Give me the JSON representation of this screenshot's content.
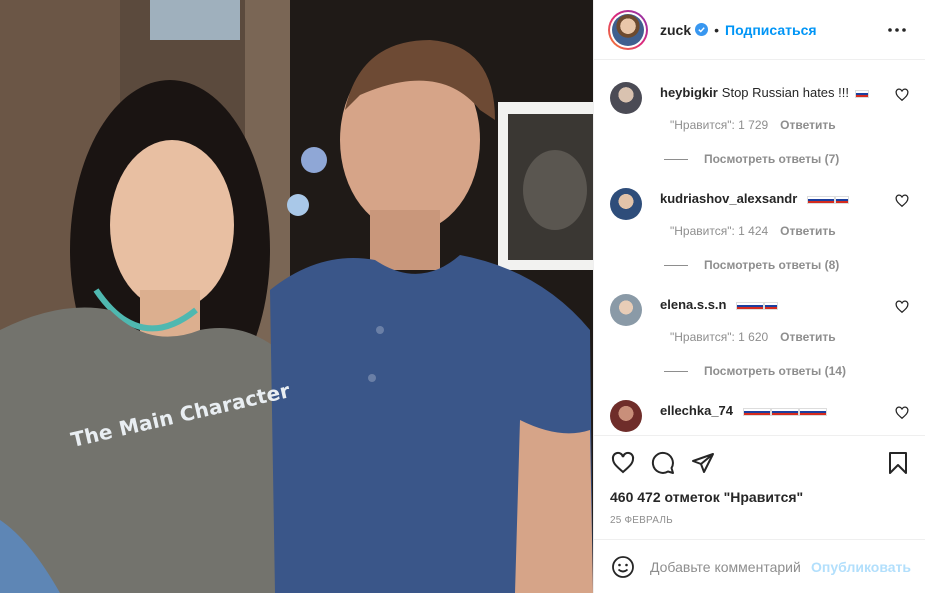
{
  "post": {
    "shirt_text": "The Main Character"
  },
  "header": {
    "username": "zuck",
    "separator": "•",
    "follow_label": "Подписаться",
    "more_icon": "more-horizontal-icon"
  },
  "comments": [
    {
      "username": "heybigkir",
      "text": "Stop Russian hates !!!",
      "flag": "ru",
      "likes": "\"Нравится\": 1 729",
      "reply": "Ответить",
      "view_replies": "Посмотреть ответы (7)"
    },
    {
      "username": "kudriashov_alexsandr",
      "text": "",
      "flag": "ru-ru",
      "likes": "\"Нравится\": 1 424",
      "reply": "Ответить",
      "view_replies": "Посмотреть ответы (8)"
    },
    {
      "username": "elena.s.s.n",
      "text": "",
      "flag": "ru-ru",
      "likes": "\"Нравится\": 1 620",
      "reply": "Ответить",
      "view_replies": "Посмотреть ответы (14)"
    },
    {
      "username": "ellechka_74",
      "text": "",
      "flag": "ru-ru-ru"
    }
  ],
  "actions": {
    "like_icon": "heart-icon",
    "comment_icon": "comment-icon",
    "share_icon": "share-icon",
    "save_icon": "bookmark-icon"
  },
  "likes_count": "460 472 отметок \"Нравится\"",
  "date": "25 ФЕВРАЛЬ",
  "add_comment": {
    "placeholder": "Добавьте комментарий...",
    "publish_label": "Опубликовать",
    "emoji_icon": "emoji-icon"
  },
  "colors": {
    "accent": "#0095f6",
    "publish_disabled": "#b2dffc",
    "muted": "#8e8e8e",
    "border": "#efefef"
  }
}
